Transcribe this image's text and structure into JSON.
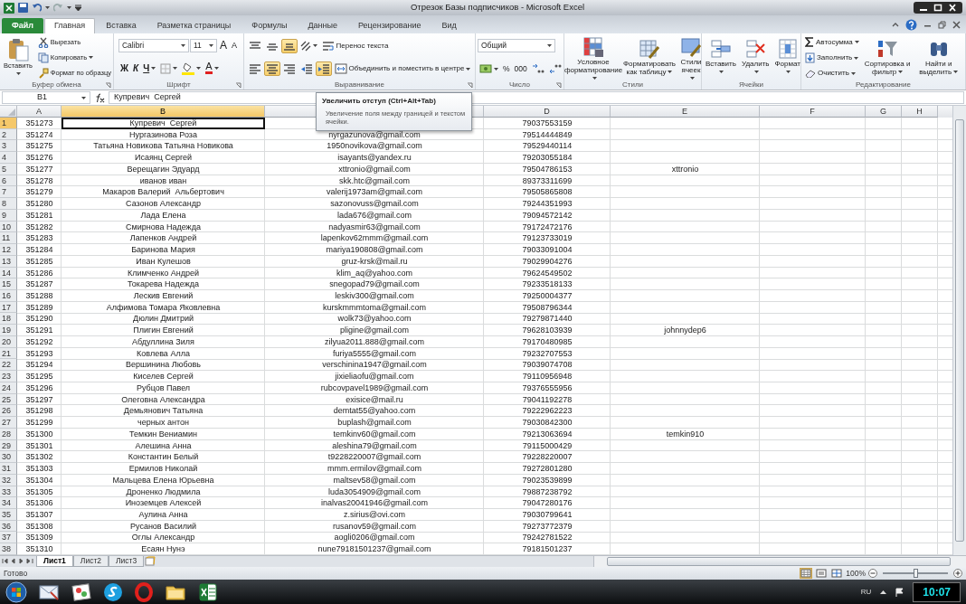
{
  "window": {
    "title": "Отрезок Базы подписчиков - Microsoft Excel"
  },
  "ribbon_tabs": [
    {
      "label": "Файл",
      "kind": "file",
      "selected": false
    },
    {
      "label": "Главная",
      "kind": "tab",
      "selected": true
    },
    {
      "label": "Вставка",
      "kind": "tab",
      "selected": false
    },
    {
      "label": "Разметка страницы",
      "kind": "tab",
      "selected": false
    },
    {
      "label": "Формулы",
      "kind": "tab",
      "selected": false
    },
    {
      "label": "Данные",
      "kind": "tab",
      "selected": false
    },
    {
      "label": "Рецензирование",
      "kind": "tab",
      "selected": false
    },
    {
      "label": "Вид",
      "kind": "tab",
      "selected": false
    }
  ],
  "ribbon_groups": [
    {
      "label": "Буфер обмена",
      "launcher": true,
      "stacks": [
        {
          "kind": "large",
          "items": [
            {
              "kind": "button",
              "label": "Вставить",
              "caret": true
            }
          ]
        },
        {
          "kind": "rows",
          "rows": [
            {
              "items": [
                {
                  "kind": "button",
                  "label": "Вырезать"
                }
              ]
            },
            {
              "items": [
                {
                  "kind": "button",
                  "label": "Копировать",
                  "caret": true
                }
              ]
            },
            {
              "items": [
                {
                  "kind": "button",
                  "label": "Формат по образцу"
                }
              ]
            }
          ]
        }
      ]
    },
    {
      "label": "Шрифт",
      "launcher": true,
      "stacks": [
        {
          "kind": "rows",
          "rows": [
            {
              "items": [
                {
                  "kind": "field",
                  "value": "Calibri"
                },
                {
                  "kind": "field",
                  "value": "11"
                },
                {
                  "kind": "glyph",
                  "label": "A"
                },
                {
                  "kind": "glyph",
                  "label": "A"
                }
              ]
            },
            {
              "items": [
                {
                  "kind": "glyph",
                  "label": "Ж"
                },
                {
                  "kind": "glyph",
                  "label": "К"
                },
                {
                  "kind": "glyph",
                  "label": "Ч",
                  "caret": true
                },
                {
                  "kind": "button",
                  "caret": true
                },
                {
                  "kind": "button",
                  "caret": true
                },
                {
                  "kind": "glyph",
                  "label": "A",
                  "caret": true
                }
              ]
            }
          ]
        }
      ]
    },
    {
      "label": "Выравнивание",
      "launcher": true,
      "stacks": [
        {
          "kind": "rows",
          "rows": [
            {
              "items": [
                {
                  "kind": "button",
                  "selected": false
                },
                {
                  "kind": "button",
                  "selected": false
                },
                {
                  "kind": "button",
                  "selected": true
                },
                {
                  "kind": "button",
                  "caret": true,
                  "selected": false
                },
                {
                  "kind": "button",
                  "label": "Перенос текста",
                  "selected": false
                }
              ]
            },
            {
              "items": [
                {
                  "kind": "button",
                  "selected": false
                },
                {
                  "kind": "button",
                  "selected": true
                },
                {
                  "kind": "button",
                  "selected": false
                },
                {
                  "kind": "button",
                  "selected": false
                },
                {
                  "kind": "button",
                  "selected": true
                },
                {
                  "kind": "button",
                  "label": "Объединить и поместить в центре",
                  "caret": true,
                  "selected": false
                }
              ]
            }
          ]
        }
      ]
    },
    {
      "label": "Число",
      "launcher": true,
      "stacks": [
        {
          "kind": "rows",
          "rows": [
            {
              "items": [
                {
                  "kind": "field",
                  "value": "Общий"
                }
              ]
            },
            {
              "items": [
                {
                  "kind": "button",
                  "caret": true
                },
                {
                  "kind": "glyph",
                  "label": "%"
                },
                {
                  "kind": "glyph",
                  "label": "000"
                },
                {
                  "kind": "button"
                },
                {
                  "kind": "button"
                }
              ]
            }
          ]
        }
      ]
    },
    {
      "label": "Стили",
      "stacks": [
        {
          "kind": "large",
          "items": [
            {
              "kind": "button",
              "label": "Условное форматирование",
              "caret": true
            }
          ]
        },
        {
          "kind": "large",
          "items": [
            {
              "kind": "button",
              "label": "Форматировать как таблицу",
              "caret": true
            }
          ]
        },
        {
          "kind": "large",
          "items": [
            {
              "kind": "button",
              "label": "Стили ячеек",
              "caret": true
            }
          ]
        }
      ]
    },
    {
      "label": "Ячейки",
      "stacks": [
        {
          "kind": "large",
          "items": [
            {
              "kind": "button",
              "label": "Вставить",
              "caret": true
            }
          ]
        },
        {
          "kind": "large",
          "items": [
            {
              "kind": "button",
              "label": "Удалить",
              "caret": true
            }
          ]
        },
        {
          "kind": "large",
          "items": [
            {
              "kind": "button",
              "label": "Формат",
              "caret": true
            }
          ]
        }
      ]
    },
    {
      "label": "Редактирование",
      "stacks": [
        {
          "kind": "rows",
          "rows": [
            {
              "items": [
                {
                  "kind": "button",
                  "label": "Автосумма",
                  "caret": true
                }
              ]
            },
            {
              "items": [
                {
                  "kind": "button",
                  "label": "Заполнить",
                  "caret": true
                }
              ]
            },
            {
              "items": [
                {
                  "kind": "button",
                  "label": "Очистить",
                  "caret": true
                }
              ]
            }
          ]
        },
        {
          "kind": "large",
          "items": [
            {
              "kind": "button",
              "label": "Сортировка и фильтр",
              "caret": true
            }
          ]
        },
        {
          "kind": "large",
          "items": [
            {
              "kind": "button",
              "label": "Найти и выделить",
              "caret": true
            }
          ]
        }
      ]
    }
  ],
  "formula_bar": {
    "name_box": "B1",
    "formula": "Купревич  Сергей"
  },
  "tooltip": {
    "title": "Увеличить отступ (Ctrl+Alt+Tab)",
    "body": "Увеличение поля между границей и текстом ячейки."
  },
  "columns": [
    {
      "label": "A",
      "selected": false
    },
    {
      "label": "B",
      "selected": true
    },
    {
      "selected": false
    },
    {
      "label": "D",
      "selected": false
    },
    {
      "label": "E",
      "selected": false
    },
    {
      "label": "F",
      "selected": false
    },
    {
      "label": "G",
      "selected": false
    },
    {
      "label": "H",
      "selected": false
    }
  ],
  "rows": [
    {
      "row": "1",
      "selected": true,
      "a": "351273",
      "b": "Купревич  Сергей",
      "d": "79037553159"
    },
    {
      "row": "2",
      "selected": false,
      "a": "351274",
      "b": "Нургазинова Роза",
      "c": "nyrgazunova@gmail.com",
      "d": "79514444849"
    },
    {
      "row": "3",
      "selected": false,
      "a": "351275",
      "b": "Татьяна Новикова Татьяна Новикова",
      "c": "1950novikova@gmail.com",
      "d": "79529440114"
    },
    {
      "row": "4",
      "selected": false,
      "a": "351276",
      "b": "Исаянц Сергей",
      "c": "isayants@yandex.ru",
      "d": "79203055184"
    },
    {
      "row": "5",
      "selected": false,
      "a": "351277",
      "b": "Верещагин Эдуард",
      "c": "xttronio@gmail.com",
      "d": "79504786153",
      "e": "xttronio"
    },
    {
      "row": "6",
      "selected": false,
      "a": "351278",
      "b": "иванов иван",
      "c": "skk.htc@gmail.com",
      "d": "89373311699"
    },
    {
      "row": "7",
      "selected": false,
      "a": "351279",
      "b": "Макаров Валерий  Альбертович",
      "c": "valerij1973am@gmail.com",
      "d": "79505865808"
    },
    {
      "row": "8",
      "selected": false,
      "a": "351280",
      "b": "Сазонов Александр",
      "c": "sazonovuss@gmail.com",
      "d": "79244351993"
    },
    {
      "row": "9",
      "selected": false,
      "a": "351281",
      "b": "Лада Елена",
      "c": "lada676@gmail.com",
      "d": "79094572142"
    },
    {
      "row": "10",
      "selected": false,
      "a": "351282",
      "b": "Смирнова Надежда",
      "c": "nadyasmir63@gmail.com",
      "d": "79172472176"
    },
    {
      "row": "11",
      "selected": false,
      "a": "351283",
      "b": "Лапенков Андрей",
      "c": "lapenkov62mmm@gmail.com",
      "d": "79123733019"
    },
    {
      "row": "12",
      "selected": false,
      "a": "351284",
      "b": "Баринова Мария",
      "c": "mariya190808@gmail.com",
      "d": "79033091004"
    },
    {
      "row": "13",
      "selected": false,
      "a": "351285",
      "b": "Иван Кулешов",
      "c": "gruz-krsk@mail.ru",
      "d": "79029904276"
    },
    {
      "row": "14",
      "selected": false,
      "a": "351286",
      "b": "Климченко Андрей",
      "c": "klim_aq@yahoo.com",
      "d": "79624549502"
    },
    {
      "row": "15",
      "selected": false,
      "a": "351287",
      "b": "Токарева Надежда",
      "c": "snegopad79@gmail.com",
      "d": "79233518133"
    },
    {
      "row": "16",
      "selected": false,
      "a": "351288",
      "b": "Лескив Евгений",
      "c": "leskiv300@gmail.com",
      "d": "79250004377"
    },
    {
      "row": "17",
      "selected": false,
      "a": "351289",
      "b": "Алфимова Томара Яковлевна",
      "c": "kurskmmmtoma@gmail.com",
      "d": "79508796344"
    },
    {
      "row": "18",
      "selected": false,
      "a": "351290",
      "b": "Дюлин Дмитрий",
      "c": "wolk73@yahoo.com",
      "d": "79279871440"
    },
    {
      "row": "19",
      "selected": false,
      "a": "351291",
      "b": "Плигин Евгений",
      "c": "pligine@gmail.com",
      "d": "79628103939",
      "e": "johnnydep6"
    },
    {
      "row": "20",
      "selected": false,
      "a": "351292",
      "b": "Абдуллина Зиля",
      "c": "zilyua2011.888@gmail.com",
      "d": "79170480985"
    },
    {
      "row": "21",
      "selected": false,
      "a": "351293",
      "b": "Ковлева Алла",
      "c": "furiya5555@gmail.com",
      "d": "79232707553"
    },
    {
      "row": "22",
      "selected": false,
      "a": "351294",
      "b": "Вершинина Любовь",
      "c": "verschinina1947@gmail.com",
      "d": "79039074708"
    },
    {
      "row": "23",
      "selected": false,
      "a": "351295",
      "b": "Киселев Сергей",
      "c": "jixieliaofu@gmail.com",
      "d": "79110956948"
    },
    {
      "row": "24",
      "selected": false,
      "a": "351296",
      "b": "Рубцов Павел",
      "c": "rubcovpavel1989@gmail.com",
      "d": "79376555956"
    },
    {
      "row": "25",
      "selected": false,
      "a": "351297",
      "b": "Олеговна Александра",
      "c": "exisice@mail.ru",
      "d": "79041192278"
    },
    {
      "row": "26",
      "selected": false,
      "a": "351298",
      "b": "Демьянович Татьяна",
      "c": "demtat55@yahoo.com",
      "d": "79222962223"
    },
    {
      "row": "27",
      "selected": false,
      "a": "351299",
      "b": "черных антон",
      "c": "buplash@gmail.com",
      "d": "79030842300"
    },
    {
      "row": "28",
      "selected": false,
      "a": "351300",
      "b": "Темкин Вениамин",
      "c": "temkinv60@gmail.com",
      "d": "79213063694",
      "e": "temkin910"
    },
    {
      "row": "29",
      "selected": false,
      "a": "351301",
      "b": "Алешина Анна",
      "c": "aleshina79@gmail.com",
      "d": "79115000429"
    },
    {
      "row": "30",
      "selected": false,
      "a": "351302",
      "b": "Константин Белый",
      "c": "t9228220007@gmail.com",
      "d": "79228220007"
    },
    {
      "row": "31",
      "selected": false,
      "a": "351303",
      "b": "Ермилов Николай",
      "c": "mmm.ermilov@gmail.com",
      "d": "79272801280"
    },
    {
      "row": "32",
      "selected": false,
      "a": "351304",
      "b": "Мальцева Елена Юрьевна",
      "c": "maltsev58@gmail.com",
      "d": "79023539899"
    },
    {
      "row": "33",
      "selected": false,
      "a": "351305",
      "b": "Дроненко Людмила",
      "c": "luda3054909@gmail.com",
      "d": "79887238792"
    },
    {
      "row": "34",
      "selected": false,
      "a": "351306",
      "b": "Иноземцев Алексей",
      "c": "inalvas20041946@gmail.com",
      "d": "79047280176"
    },
    {
      "row": "35",
      "selected": false,
      "a": "351307",
      "b": "Аулина Анна",
      "c": "z.sirius@ovi.com",
      "d": "79030799641"
    },
    {
      "row": "36",
      "selected": false,
      "a": "351308",
      "b": "Русанов Василий",
      "c": "rusanov59@gmail.com",
      "d": "79273772379"
    },
    {
      "row": "37",
      "selected": false,
      "a": "351309",
      "b": "Оглы Александр",
      "c": "aogli0206@gmail.com",
      "d": "79242781522"
    },
    {
      "row": "38",
      "selected": false,
      "a": "351310",
      "b": "Есаян Нунэ",
      "c": "nune79181501237@gmail.com",
      "d": "79181501237"
    }
  ],
  "sheet_tabs": [
    {
      "label": "Лист1",
      "selected": true
    },
    {
      "label": "Лист2",
      "selected": false
    },
    {
      "label": "Лист3",
      "selected": false
    }
  ],
  "status_bar": {
    "text": "Готово",
    "views": [
      {
        "selected": true
      },
      {
        "selected": false
      },
      {
        "selected": false
      }
    ],
    "zoom": "100%",
    "zoom_slider": {
      "level": 0.5
    }
  },
  "taskbar": {
    "language": "RU",
    "clock": "10:07"
  }
}
